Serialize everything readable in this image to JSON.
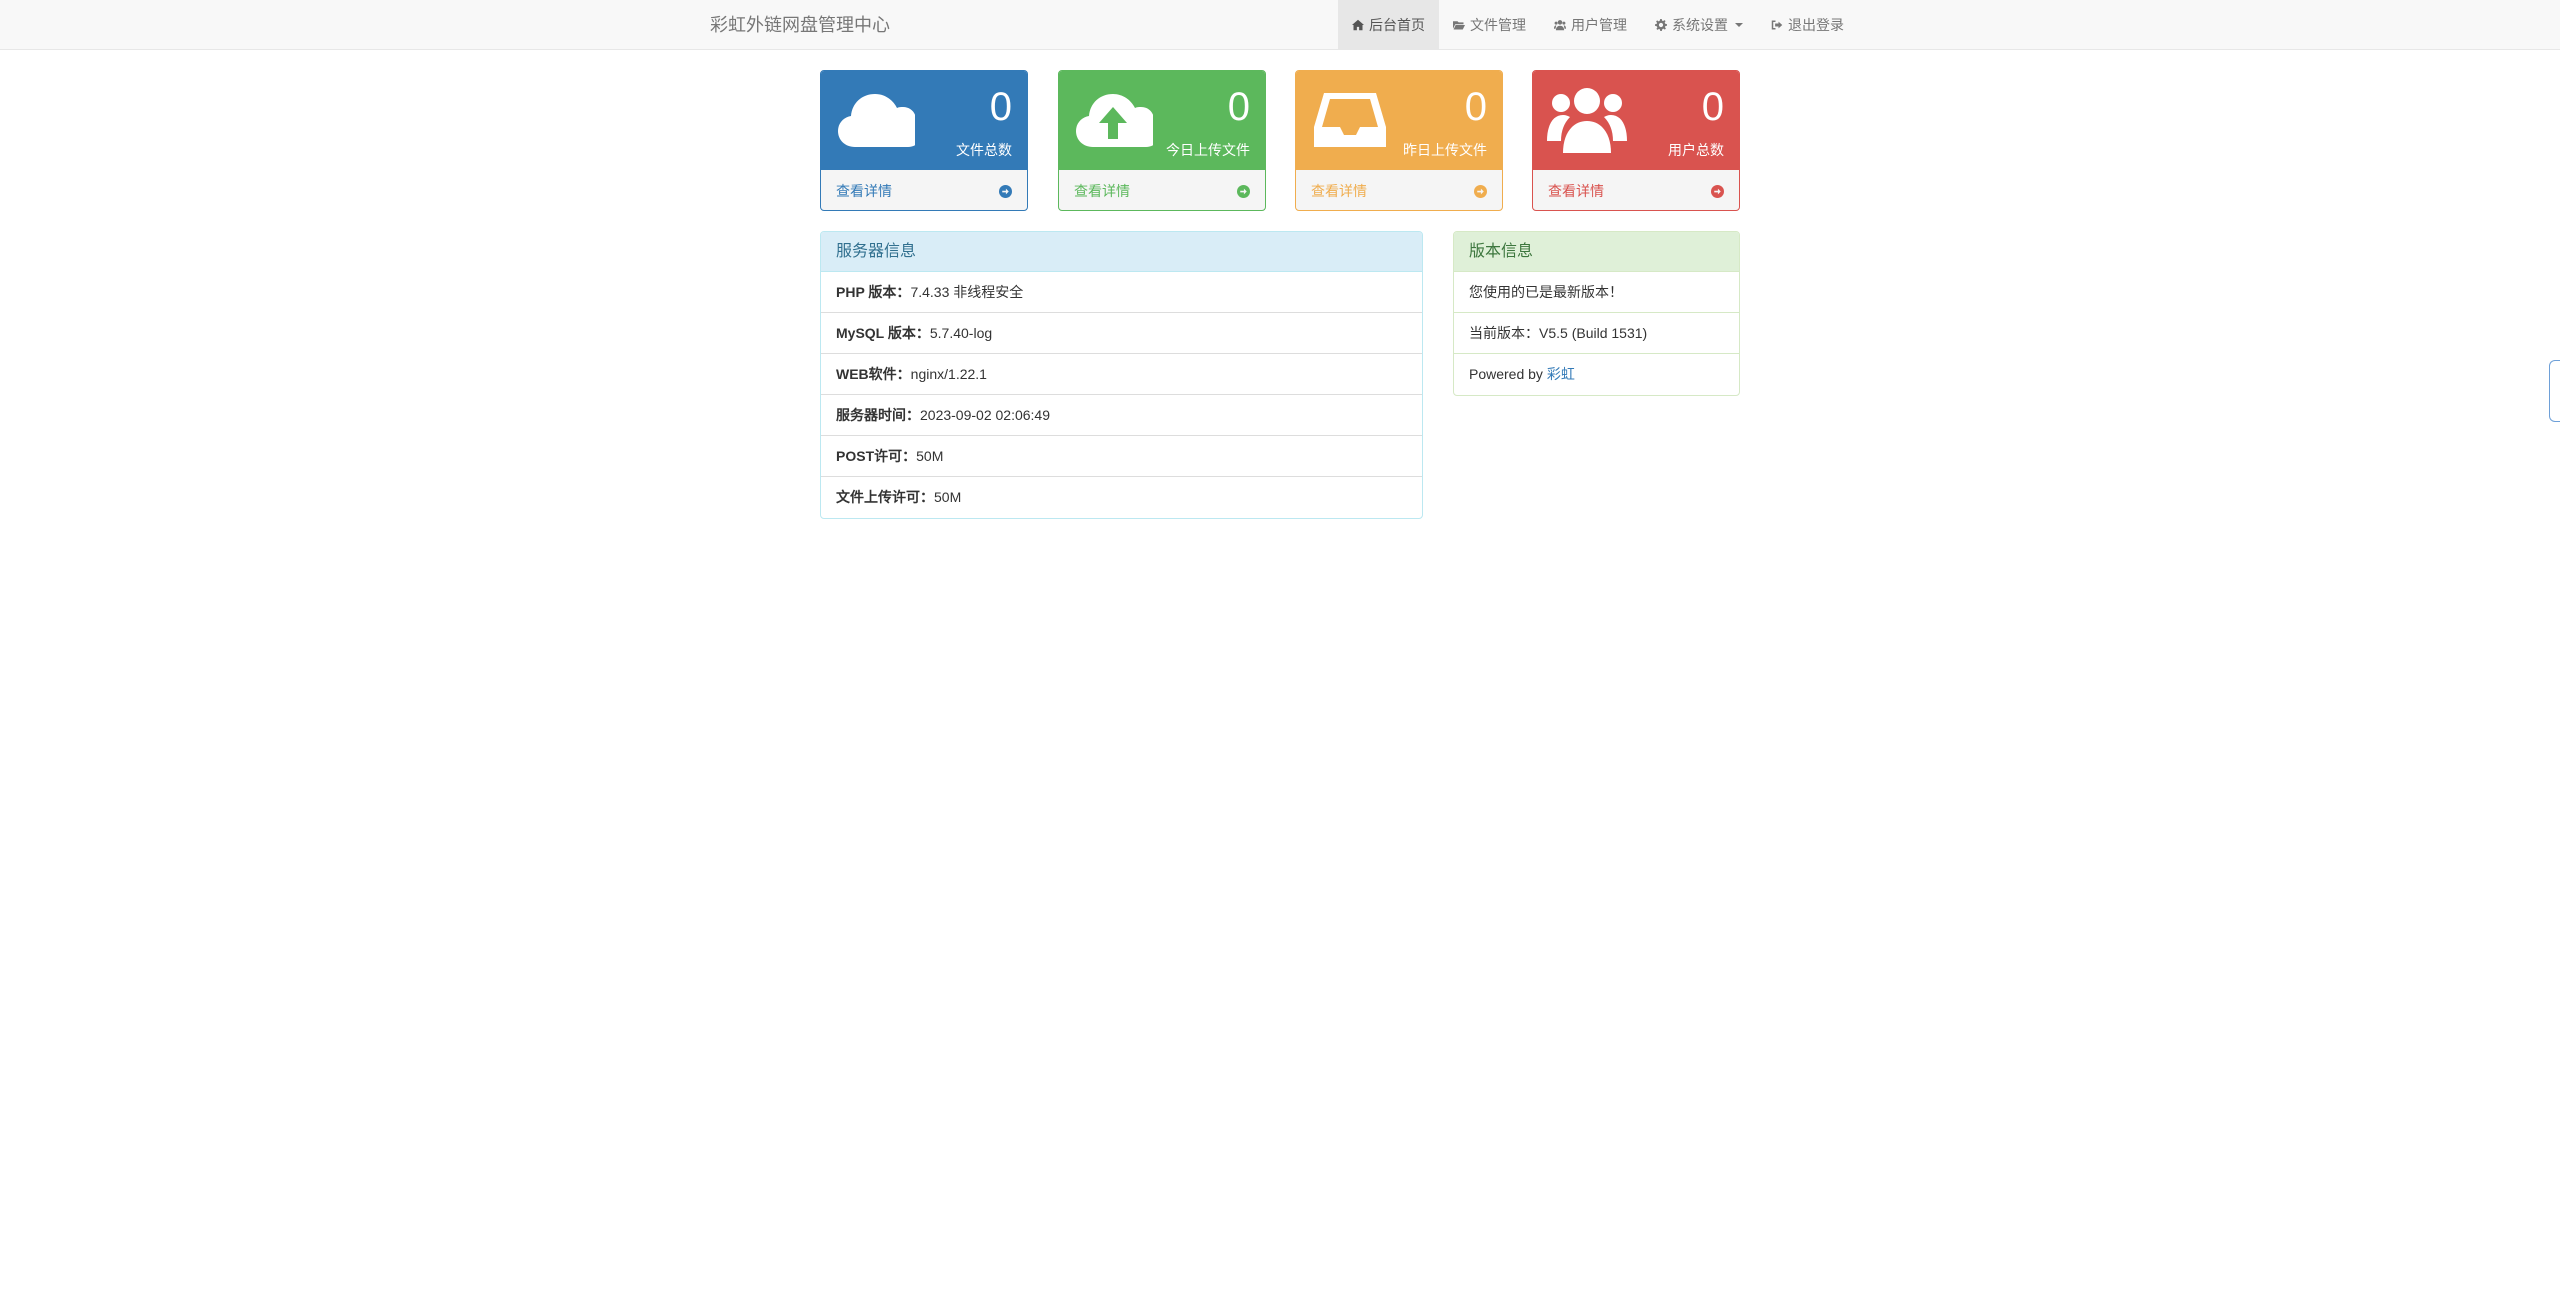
{
  "brand": "彩虹外链网盘管理中心",
  "nav": {
    "home": "后台首页",
    "files": "文件管理",
    "users": "用户管理",
    "settings": "系统设置",
    "logout": "退出登录"
  },
  "colors": {
    "blue": "#337ab7",
    "green": "#5cb85c",
    "orange": "#f0ad4e",
    "red": "#d9534f"
  },
  "cards": [
    {
      "count": "0",
      "caption": "文件总数",
      "link": "查看详情",
      "icon": "cloud-icon"
    },
    {
      "count": "0",
      "caption": "今日上传文件",
      "link": "查看详情",
      "icon": "cloud-upload-icon"
    },
    {
      "count": "0",
      "caption": "昨日上传文件",
      "link": "查看详情",
      "icon": "inbox-icon"
    },
    {
      "count": "0",
      "caption": "用户总数",
      "link": "查看详情",
      "icon": "users-icon"
    }
  ],
  "server": {
    "title": "服务器信息",
    "rows": [
      {
        "label": "PHP 版本：",
        "value": "7.4.33 非线程安全"
      },
      {
        "label": "MySQL 版本：",
        "value": "5.7.40-log"
      },
      {
        "label": "WEB软件：",
        "value": "nginx/1.22.1"
      },
      {
        "label": "服务器时间：",
        "value": "2023-09-02 02:06:49"
      },
      {
        "label": "POST许可：",
        "value": "50M"
      },
      {
        "label": "文件上传许可：",
        "value": "50M"
      }
    ]
  },
  "version": {
    "title": "版本信息",
    "latest": "您使用的已是最新版本！",
    "current_label": "当前版本：",
    "current_value": "V5.5 (Build 1531)",
    "powered_prefix": "Powered by ",
    "powered_link": "彩虹"
  }
}
